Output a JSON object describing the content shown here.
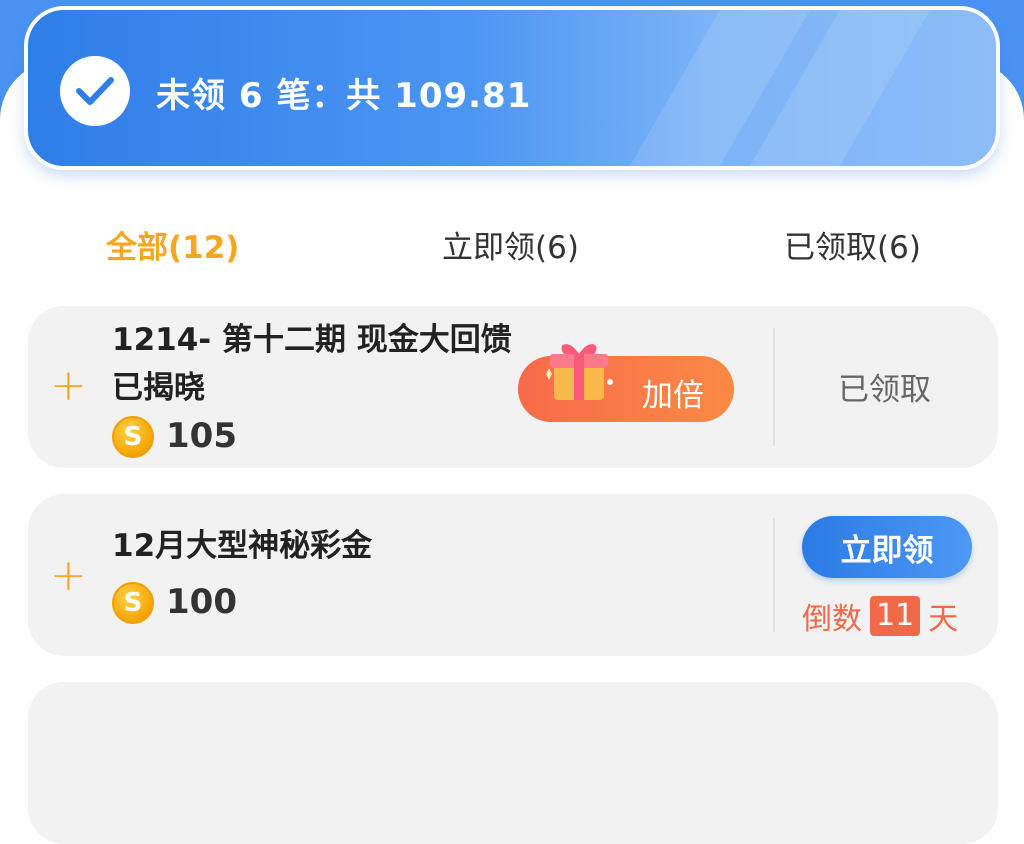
{
  "banner": {
    "summary": "未领 6 笔：共 109.81",
    "icon": "check-icon"
  },
  "tabs": [
    {
      "label": "全部(12)",
      "active": true
    },
    {
      "label": "立即领(6)",
      "active": false
    },
    {
      "label": "已领取(6)",
      "active": false
    }
  ],
  "items": [
    {
      "title": "1214- 第十二期 现金大回馈 已揭晓",
      "coin_symbol": "S",
      "amount": "105",
      "double_label": "加倍",
      "status_label": "已领取"
    },
    {
      "title": "12月大型神秘彩金",
      "coin_symbol": "S",
      "amount": "100",
      "claim_label": "立即领",
      "countdown_prefix": "倒数",
      "countdown_days": "11",
      "countdown_suffix": "天"
    }
  ],
  "colors": {
    "accent_orange": "#f5a623",
    "primary_blue": "#2f7ee8",
    "countdown_red": "#f06a4a"
  }
}
